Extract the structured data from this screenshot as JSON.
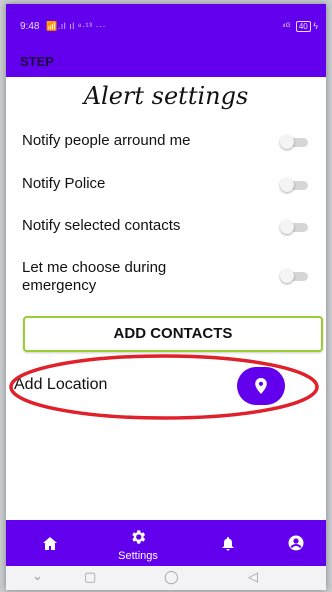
{
  "status_bar": {
    "time": "9:48",
    "signal": "📶.ıl ıl ⁸·¹³ ···",
    "right": "⁴ᴳ",
    "battery": "40"
  },
  "app_bar": {
    "title": "STEP"
  },
  "page": {
    "title": "Alert settings"
  },
  "settings": [
    {
      "label": "Notify people arround me",
      "enabled": false
    },
    {
      "label": "Notify Police",
      "enabled": false
    },
    {
      "label": "Notify selected contacts",
      "enabled": false
    },
    {
      "label": "Let me choose during emergency",
      "enabled": false
    }
  ],
  "add_contacts": {
    "label": "ADD CONTACTS"
  },
  "location": {
    "label": "Add Location"
  },
  "bottom_nav": {
    "items": [
      {
        "icon": "home-icon"
      },
      {
        "icon": "gear-icon",
        "label": "Settings",
        "active": true
      },
      {
        "icon": "bell-icon"
      },
      {
        "icon": "account-icon"
      }
    ]
  },
  "system_nav": {
    "icons": [
      "back-chevron-icon",
      "recents-square-icon",
      "home-circle-icon",
      "back-triangle-icon"
    ]
  },
  "colors": {
    "primary": "#6200ee",
    "button_border": "#9acd32",
    "highlight": "#e0202a"
  }
}
